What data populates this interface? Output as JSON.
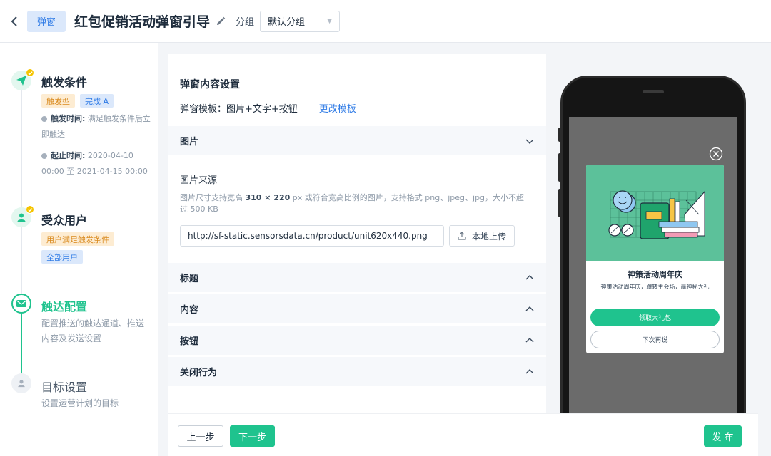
{
  "header": {
    "type_tag": "弹窗",
    "title": "红包促销活动弹窗引导",
    "group_label": "分组",
    "group_value": "默认分组"
  },
  "steps": [
    {
      "title": "触发条件",
      "tags": [
        "触发型",
        "完成 A"
      ],
      "meta": [
        {
          "label": "触发时间:",
          "value": "满足触发条件后立即触达"
        },
        {
          "label": "起止时间:",
          "value": "2020-04-10 00:00 至 2021-04-15 00:00"
        }
      ],
      "status": "done"
    },
    {
      "title": "受众用户",
      "tags": [
        "用户满足触发条件",
        "全部用户"
      ],
      "status": "done"
    },
    {
      "title": "触达配置",
      "desc": "配置推送的触达通道、推送内容及发送设置",
      "status": "active"
    },
    {
      "title": "目标设置",
      "desc": "设置运营计划的目标",
      "status": "todo"
    }
  ],
  "content": {
    "section_title": "弹窗内容设置",
    "template_label": "弹窗模板：图片+文字+按钮",
    "change_template": "更改模板",
    "accordions": [
      "图片",
      "标题",
      "内容",
      "按钮",
      "关闭行为"
    ],
    "image_source_title": "图片来源",
    "image_hint_prefix": "图片尺寸支持宽高 ",
    "image_hint_size": "310 × 220",
    "image_hint_suffix": " px 或符合宽高比例的图片，支持格式 png、jpeg、jpg，大小不超过 500 KB",
    "image_url": "http://sf-static.sensorsdata.cn/product/unit620x440.png",
    "upload_label": "本地上传"
  },
  "footer": {
    "prev": "上一步",
    "next": "下一步",
    "publish": "发 布"
  },
  "preview": {
    "popup_title": "神策活动周年庆",
    "popup_sub": "神策活动周年庆，跳转主会场，赢神秘大礼",
    "main_button": "领取大礼包",
    "secondary_button": "下次再说"
  },
  "colors": {
    "primary_green": "#1fc38e",
    "link_blue": "#2f7be6",
    "tag_orange": "#d98a1e",
    "popup_art_bg": "#5cc19a"
  }
}
